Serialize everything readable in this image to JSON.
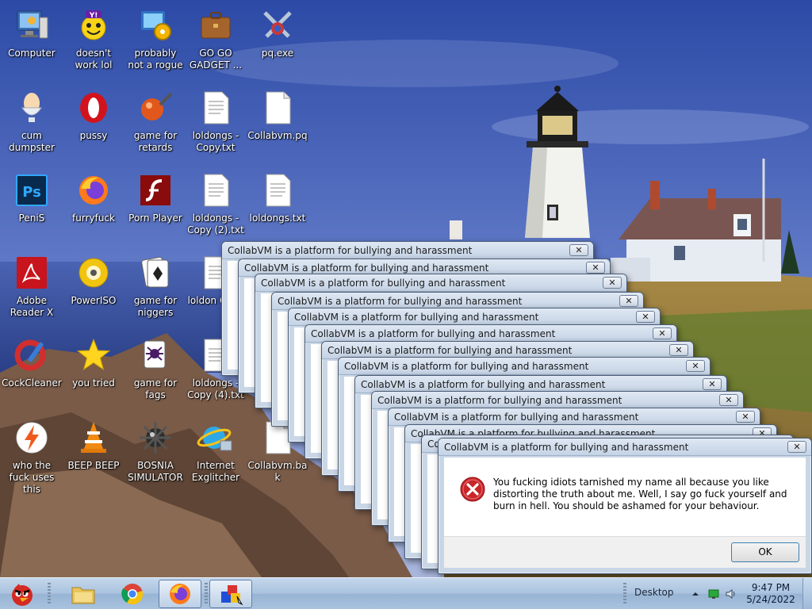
{
  "desktop": {
    "icons": [
      {
        "label": "Computer",
        "glyph": "computer-icon"
      },
      {
        "label": "doesn't work lol",
        "glyph": "yahoo-messenger-icon"
      },
      {
        "label": "probably not a rogue",
        "glyph": "system-settings-icon"
      },
      {
        "label": "GO GO GADGET ...",
        "glyph": "briefcase-icon"
      },
      {
        "label": "pq.exe",
        "glyph": "crossed-swords-icon"
      },
      {
        "label": "cum dumpster",
        "glyph": "egg-cup-icon"
      },
      {
        "label": "pussy",
        "glyph": "opera-icon"
      },
      {
        "label": "game for retards",
        "glyph": "pinball-icon"
      },
      {
        "label": "loldongs - Copy.txt",
        "glyph": "text-file-icon"
      },
      {
        "label": "Collabvm.pq",
        "glyph": "blank-file-icon"
      },
      {
        "label": "PeniS",
        "glyph": "photoshop-icon"
      },
      {
        "label": "furryfuck",
        "glyph": "firefox-icon"
      },
      {
        "label": "Porn Player",
        "glyph": "flash-icon"
      },
      {
        "label": "loldongs - Copy (2).txt",
        "glyph": "text-file-icon"
      },
      {
        "label": "loldongs.txt",
        "glyph": "text-file-icon"
      },
      {
        "label": "Adobe Reader X",
        "glyph": "adobe-reader-icon"
      },
      {
        "label": "PowerISO",
        "glyph": "disc-icon"
      },
      {
        "label": "game for niggers",
        "glyph": "cards-icon"
      },
      {
        "label": "loldon Copy",
        "glyph": "text-file-icon"
      },
      {
        "label": "CockCleaner",
        "glyph": "ccleaner-icon"
      },
      {
        "label": "you tried",
        "glyph": "star-icon"
      },
      {
        "label": "game for fags",
        "glyph": "spider-solitaire-icon"
      },
      {
        "label": "loldongs - Copy (4).txt",
        "glyph": "text-file-icon"
      },
      {
        "label": "who the fuck uses this",
        "glyph": "lightning-icon"
      },
      {
        "label": "BEEP BEEP",
        "glyph": "vlc-cone-icon"
      },
      {
        "label": "BOSNIA SIMULATOR",
        "glyph": "mine-icon"
      },
      {
        "label": "Internet Exglitcher",
        "glyph": "internet-explorer-icon"
      },
      {
        "label": "Collabvm.bak",
        "glyph": "blank-file-icon"
      }
    ]
  },
  "dialogs": {
    "title": "CollabVM is a platform for bullying and harassment",
    "close_glyph": "✕",
    "front": {
      "message": "You fucking idiots tarnished my name all because you like distorting the truth about me. Well, I say go fuck yourself and burn in hell. You should be ashamed for your behaviour.",
      "ok_label": "OK"
    }
  },
  "taskbar": {
    "desktop_label": "Desktop",
    "time": "9:47 PM",
    "date": "5/24/2022",
    "pinned": [
      "angry-bird-start-icon",
      "folder-icon",
      "chrome-icon",
      "firefox-icon",
      "paint-blocks-icon"
    ]
  },
  "colors": {
    "sky_top": "#2f4fa8",
    "sky_bottom": "#8fa6d8",
    "error_red": "#c8262a",
    "taskbar": "#a9c2de"
  }
}
